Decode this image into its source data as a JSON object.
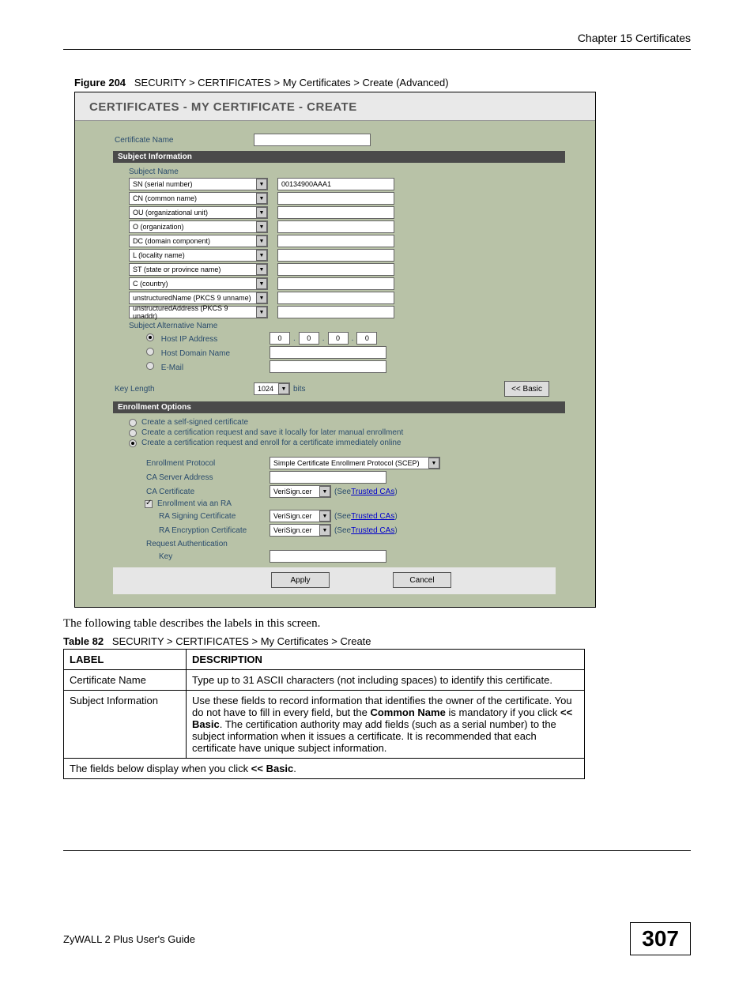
{
  "chapter": "Chapter 15 Certificates",
  "figure_label": "Figure 204",
  "figure_caption": "SECURITY > CERTIFICATES > My Certificates > Create (Advanced)",
  "shot": {
    "title": "CERTIFICATES - MY CERTIFICATE - CREATE",
    "cert_name_label": "Certificate Name",
    "section_subject": "Subject Information",
    "subject_name_label": "Subject Name",
    "subjects": [
      {
        "dd": "SN (serial number)",
        "val": "00134900AAA1"
      },
      {
        "dd": "CN (common name)",
        "val": ""
      },
      {
        "dd": "OU (organizational unit)",
        "val": ""
      },
      {
        "dd": "O (organization)",
        "val": ""
      },
      {
        "dd": "DC (domain component)",
        "val": ""
      },
      {
        "dd": "L (locality name)",
        "val": ""
      },
      {
        "dd": "ST (state or province name)",
        "val": ""
      },
      {
        "dd": "C (country)",
        "val": ""
      },
      {
        "dd": "unstructuredName (PKCS 9 unname)",
        "val": ""
      },
      {
        "dd": "unstructuredAddress (PKCS 9 unaddr)",
        "val": ""
      }
    ],
    "san_label": "Subject Alternative Name",
    "san_hostip": "Host IP Address",
    "san_hostdomain": "Host Domain Name",
    "san_email": "E-Mail",
    "ip_octet": "0",
    "keylen_label": "Key Length",
    "keylen_val": "1024",
    "keylen_unit": "bits",
    "basic_btn": "<< Basic",
    "section_enroll": "Enrollment Options",
    "enroll_opts": [
      "Create a self-signed certificate",
      "Create a certification request and save it locally for later manual enrollment",
      "Create a certification request and enroll for a certificate immediately online"
    ],
    "enroll_proto_label": "Enrollment Protocol",
    "enroll_proto_val": "Simple Certificate Enrollment Protocol (SCEP)",
    "ca_server_label": "CA Server Address",
    "ca_cert_label": "CA Certificate",
    "verisign": "VeriSign.cer",
    "see_trusted": "Trusted CAs",
    "see_word": "(See ",
    "close_paren": ")",
    "enroll_via_ra": "Enrollment via an RA",
    "ra_signing": "RA Signing Certificate",
    "ra_encrypt": "RA Encryption Certificate",
    "req_auth": "Request Authentication",
    "key_label": "Key",
    "apply_btn": "Apply",
    "cancel_btn": "Cancel"
  },
  "post_text": "The following table describes the labels in this screen.",
  "table_label": "Table 82",
  "table_caption": "SECURITY > CERTIFICATES > My Certificates > Create",
  "th_label": "LABEL",
  "th_desc": "DESCRIPTION",
  "rows": [
    {
      "label": "Certificate Name",
      "desc": "Type up to 31 ASCII characters (not including spaces) to identify this certificate."
    },
    {
      "label": "Subject Information",
      "desc_prefix": "Use these fields to record information that identifies the owner of the certificate. You do not have to fill in every field, but the ",
      "desc_bold1": "Common Name",
      "desc_mid": " is mandatory if you click ",
      "desc_bold2": "<< Basic",
      "desc_suffix": ". The certification authority may add fields (such as a serial number) to the subject information when it issues a certificate. It is recommended that each certificate have unique subject information."
    }
  ],
  "span_row_prefix": "The fields below display when you click ",
  "span_row_bold": "<< Basic",
  "span_row_suffix": ".",
  "footer_guide": "ZyWALL 2 Plus User's Guide",
  "page_number": "307"
}
